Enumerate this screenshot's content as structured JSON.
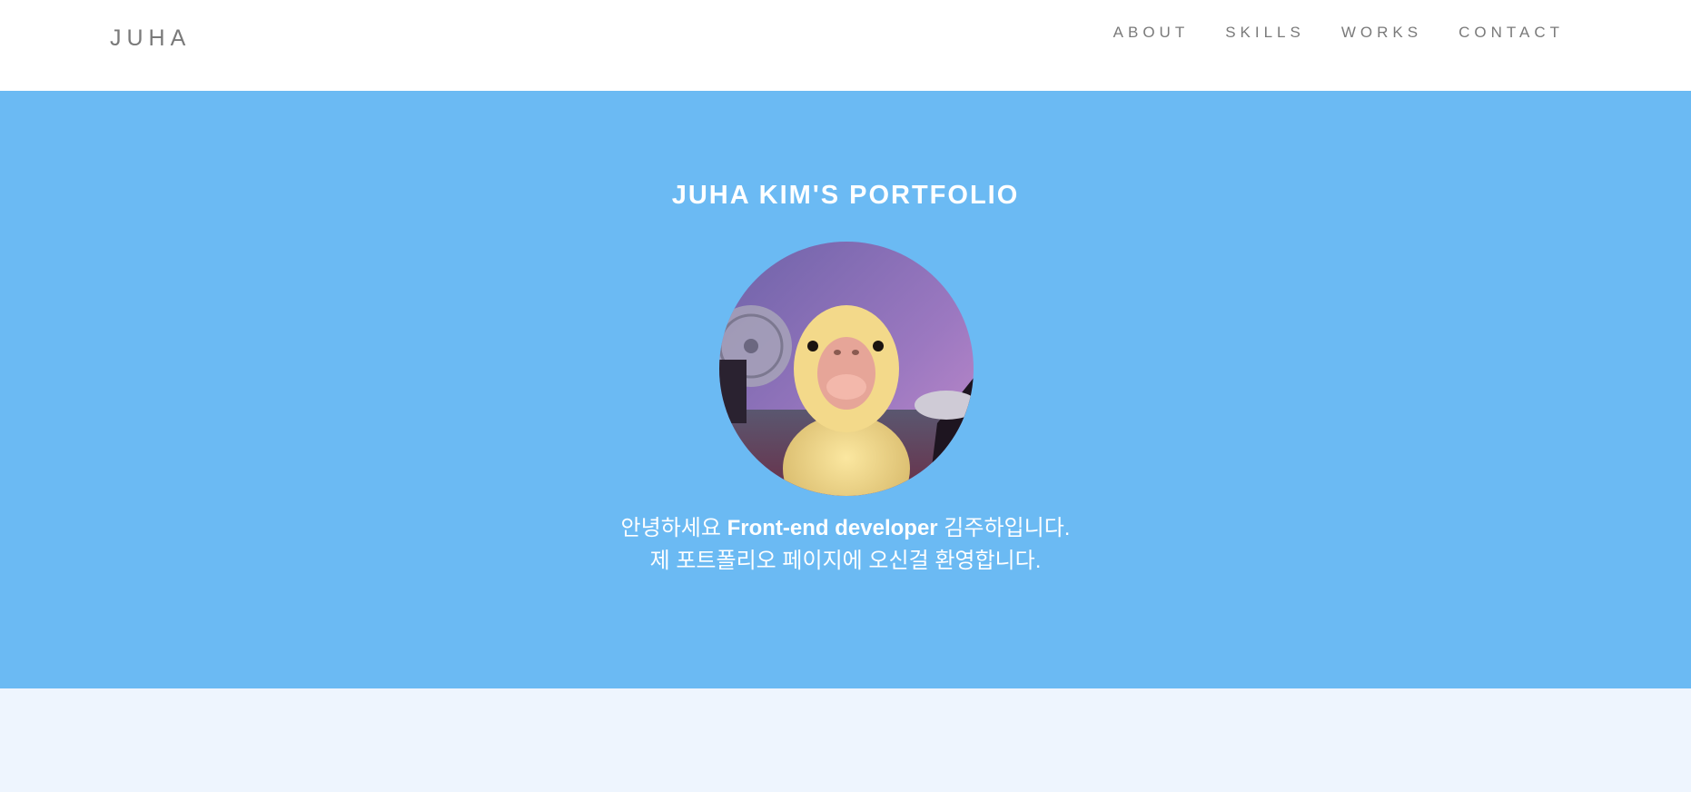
{
  "navbar": {
    "brand": "JUHA",
    "links": [
      "ABOUT",
      "SKILLS",
      "WORKS",
      "CONTACT"
    ]
  },
  "hero": {
    "title": "JUHA KIM'S PORTFOLIO",
    "intro_line1_prefix": "안녕하세요 ",
    "intro_line1_bold": "Front-end developer",
    "intro_line1_suffix": " 김주하입니다.",
    "intro_line2": "제 포트폴리오 페이지에 오신걸 환영합니다."
  },
  "colors": {
    "hero_bg": "#6bbaf3",
    "nav_bg": "#ffffff",
    "nav_text": "#7a7a7a",
    "page_bg": "#eef5fe"
  }
}
